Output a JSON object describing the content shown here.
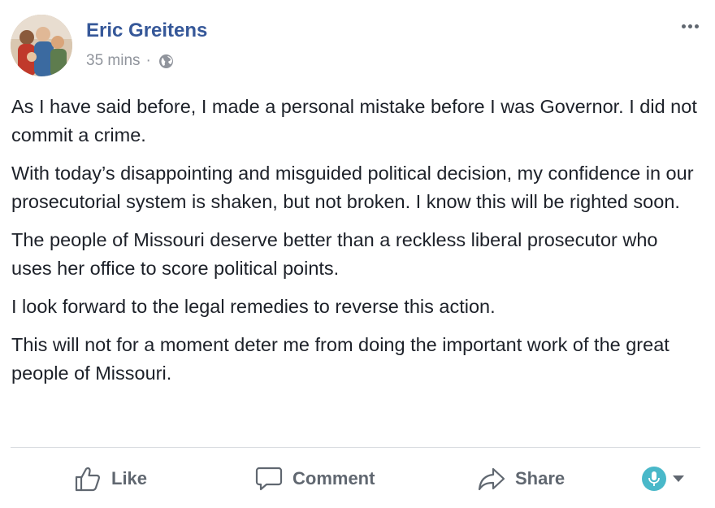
{
  "post": {
    "author": "Eric Greitens",
    "timestamp": "35 mins",
    "separator": "·",
    "privacy_icon": "globe-icon",
    "options_icon": "more-options-icon",
    "paragraphs": [
      "As I have said before, I made a personal mistake before I was Governor. I did not commit a crime.",
      "With today’s disappointing and misguided political decision, my confidence in our prosecutorial system is shaken, but not broken. I know this will be righted soon.",
      "The people of Missouri deserve better than a reckless liberal prosecutor who uses her office to score political points.",
      "I look forward to the legal remedies to reverse this action.",
      "This will not for a moment deter me from doing the important work of the great people of Missouri."
    ]
  },
  "actions": {
    "like_label": "Like",
    "comment_label": "Comment",
    "share_label": "Share",
    "like_icon": "thumbs-up-icon",
    "comment_icon": "speech-bubble-icon",
    "share_icon": "share-arrow-icon",
    "reaction_icon": "microphone-icon",
    "dropdown_icon": "caret-down-icon"
  },
  "colors": {
    "author_link": "#365899",
    "meta_text": "#90949c",
    "body_text": "#1d2129",
    "action_text": "#606770",
    "reaction_bg": "#49b8c9"
  }
}
